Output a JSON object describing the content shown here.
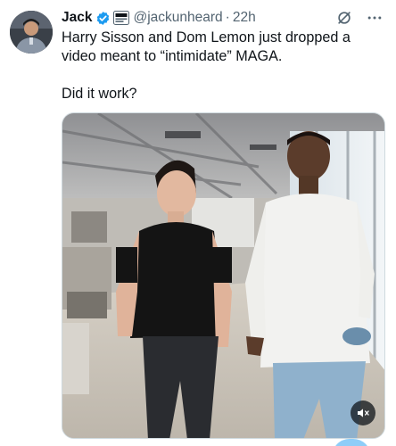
{
  "author": {
    "name": "Jack",
    "handle": "@jackunheard",
    "separator": "·",
    "time": "22h"
  },
  "icons": {
    "verified": "verified-badge-icon",
    "affiliate": "affiliate-badge-icon",
    "grok": "grok-icon",
    "more": "more-options-icon",
    "mute": "volume-muted-icon"
  },
  "tweet": {
    "line1": "Harry Sisson and Dom Lemon just dropped a video meant to “intimidate” MAGA.",
    "line2": "Did it work?"
  },
  "colors": {
    "accent": "#1d9bf0",
    "text": "#0f1419",
    "secondary": "#536471"
  }
}
